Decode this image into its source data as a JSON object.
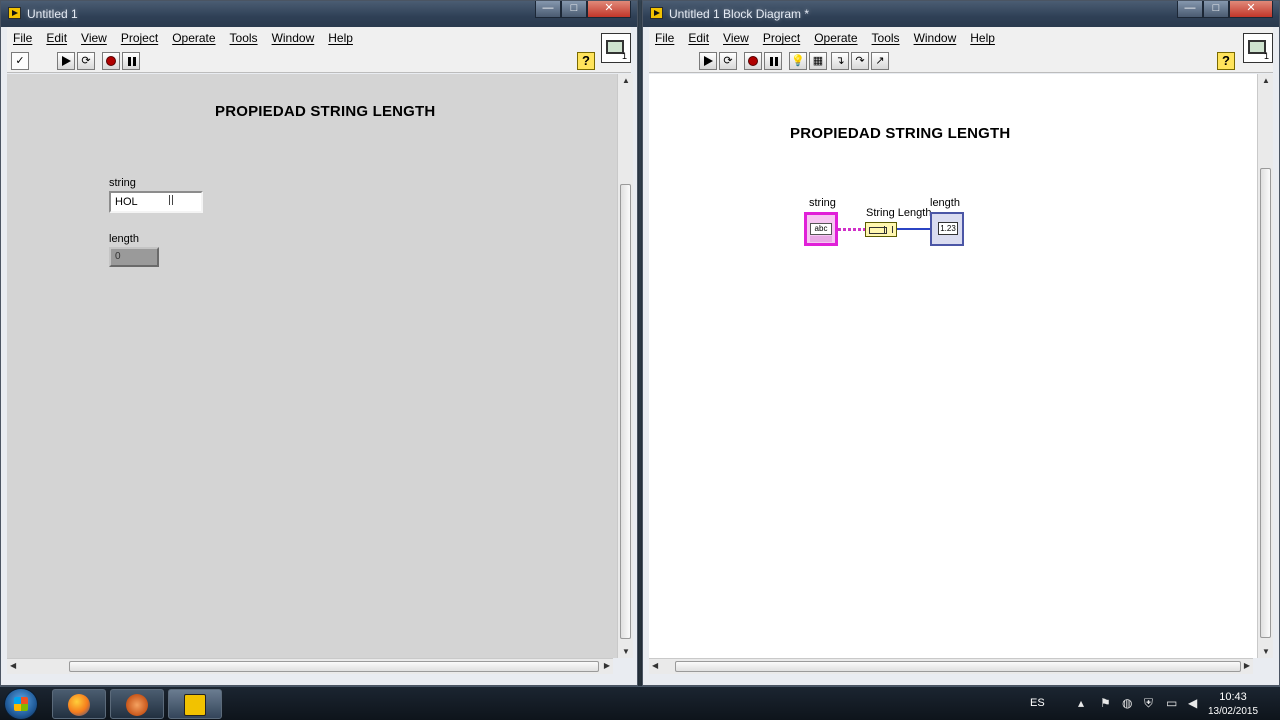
{
  "front_panel": {
    "title": "Untitled 1",
    "menu": [
      "File",
      "Edit",
      "View",
      "Project",
      "Operate",
      "Tools",
      "Window",
      "Help"
    ],
    "heading": "PROPIEDAD STRING LENGTH",
    "string_label": "string",
    "string_value": "HOL",
    "length_label": "length",
    "length_value": "0",
    "toolbar": {
      "run_arrow": "run-arrow-icon",
      "run_continuous": "run-continuously-icon",
      "abort": "abort-icon",
      "pause": "pause-icon",
      "help": "?"
    }
  },
  "block_diagram": {
    "title": "Untitled 1 Block Diagram *",
    "menu": [
      "File",
      "Edit",
      "View",
      "Project",
      "Operate",
      "Tools",
      "Window",
      "Help"
    ],
    "heading": "PROPIEDAD STRING LENGTH",
    "string_terminal_label": "string",
    "string_terminal_text": "abc",
    "function_label": "String Length",
    "length_terminal_label": "length",
    "length_terminal_text": "1.23",
    "help": "?"
  },
  "window_buttons": {
    "minimize": "—",
    "maximize": "□",
    "close": "✕"
  },
  "taskbar": {
    "language": "ES",
    "time": "10:43",
    "date": "13/02/2015",
    "apps": [
      "firefox-icon",
      "bear-paw-icon",
      "labview-icon"
    ]
  },
  "colors": {
    "panel_bg": "#d4d4d4",
    "diagram_bg": "#ffffff",
    "string_wire": "#d030c8",
    "numeric_wire": "#2b44c4",
    "title_bar": "#2f4056"
  }
}
